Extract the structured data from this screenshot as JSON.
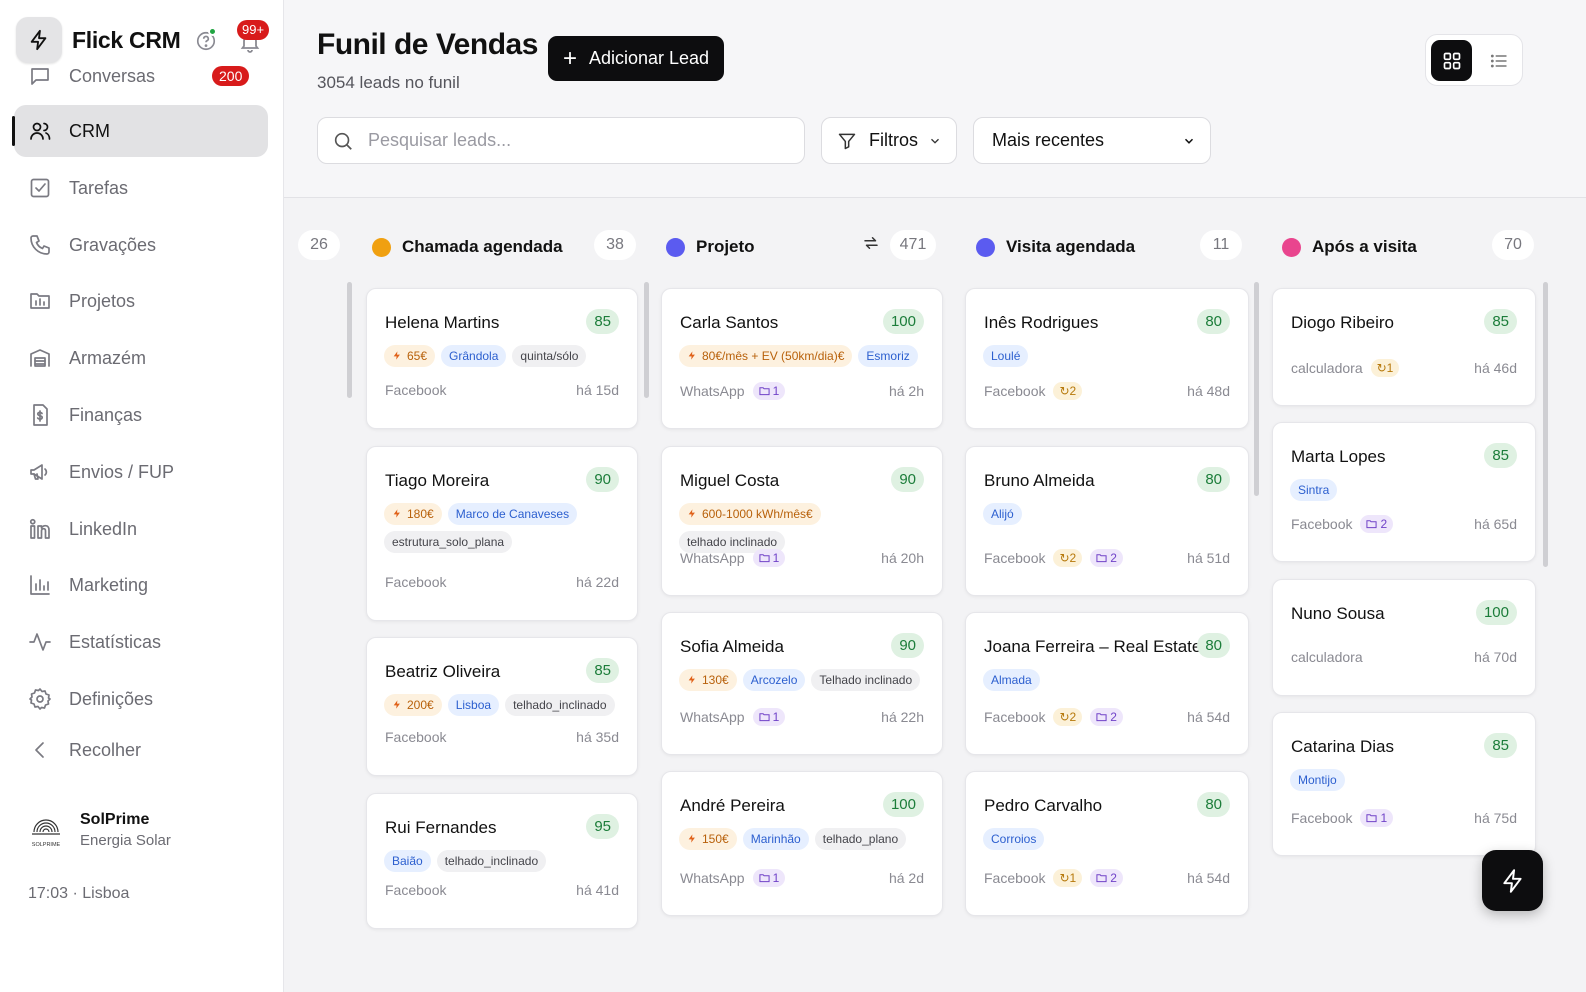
{
  "app": {
    "name": "Flick CRM",
    "notifications_badge": "99+"
  },
  "sidebar": {
    "items": [
      {
        "label": "Conversas",
        "icon": "chat-icon",
        "badge": "200"
      },
      {
        "label": "CRM",
        "icon": "users-icon",
        "active": true
      },
      {
        "label": "Tarefas",
        "icon": "checkbox-icon"
      },
      {
        "label": "Gravações",
        "icon": "phone-icon"
      },
      {
        "label": "Projetos",
        "icon": "chart-folder-icon"
      },
      {
        "label": "Armazém",
        "icon": "warehouse-icon"
      },
      {
        "label": "Finanças",
        "icon": "dollar-file-icon"
      },
      {
        "label": "Envios / FUP",
        "icon": "megaphone-icon"
      },
      {
        "label": "LinkedIn",
        "icon": "linkedin-icon"
      },
      {
        "label": "Marketing",
        "icon": "bar-chart-icon"
      },
      {
        "label": "Estatísticas",
        "icon": "activity-icon"
      },
      {
        "label": "Definições",
        "icon": "settings-icon"
      },
      {
        "label": "Recolher",
        "icon": "chevron-left-icon"
      }
    ],
    "org": {
      "name": "SolPrime",
      "subtitle": "Energia Solar",
      "logo_text": "SOLPRIME"
    },
    "clock": "17:03 · Lisboa"
  },
  "header": {
    "title": "Funil de Vendas",
    "subtitle": "3054 leads no funil",
    "add_button": "Adicionar Lead",
    "search_placeholder": "Pesquisar leads...",
    "filters_label": "Filtros",
    "sort_selected": "Mais recentes"
  },
  "board": {
    "hidden_count": "26",
    "columns": [
      {
        "title": "Chamada agendada",
        "count": "38",
        "color": "#f0a010",
        "cards": [
          {
            "name": "Helena Martins",
            "score": "85",
            "tags": [
              {
                "t": "value",
                "v": "65€"
              },
              {
                "t": "loc",
                "v": "Grândola"
              },
              {
                "t": "plain",
                "v": "quinta/sólo"
              }
            ],
            "source": "Facebook",
            "time": "há 15d"
          },
          {
            "name": "Tiago Moreira",
            "score": "90",
            "tags": [
              {
                "t": "value",
                "v": "180€"
              },
              {
                "t": "loc",
                "v": "Marco de Canaveses"
              },
              {
                "t": "plain",
                "v": "estrutura_solo_plana"
              }
            ],
            "source": "Facebook",
            "time": "há 22d"
          },
          {
            "name": "Beatriz Oliveira",
            "score": "85",
            "tags": [
              {
                "t": "value",
                "v": "200€"
              },
              {
                "t": "loc",
                "v": "Lisboa"
              },
              {
                "t": "plain",
                "v": "telhado_inclinado"
              }
            ],
            "source": "Facebook",
            "time": "há 35d"
          },
          {
            "name": "Rui Fernandes",
            "score": "95",
            "tags": [
              {
                "t": "loc",
                "v": "Baião"
              },
              {
                "t": "plain",
                "v": "telhado_inclinado"
              }
            ],
            "source": "Facebook",
            "time": "há 41d"
          }
        ]
      },
      {
        "title": "Projeto",
        "count": "471",
        "color": "#5b5bf0",
        "cards": [
          {
            "name": "Carla Santos",
            "score": "100",
            "tags": [
              {
                "t": "value",
                "v": "80€/mês + EV (50km/dia)€"
              },
              {
                "t": "loc",
                "v": "Esmoriz"
              }
            ],
            "source": "WhatsApp",
            "proj": "1",
            "time": "há 2h"
          },
          {
            "name": "Miguel Costa",
            "score": "90",
            "tags": [
              {
                "t": "value",
                "v": "600-1000 kWh/mês€"
              },
              {
                "t": "plain",
                "v": "telhado inclinado"
              }
            ],
            "source": "WhatsApp",
            "proj": "1",
            "time": "há 20h"
          },
          {
            "name": "Sofia Almeida",
            "score": "90",
            "tags": [
              {
                "t": "value",
                "v": "130€"
              },
              {
                "t": "loc",
                "v": "Arcozelo"
              },
              {
                "t": "plain",
                "v": "Telhado inclinado"
              }
            ],
            "source": "WhatsApp",
            "proj": "1",
            "time": "há 22h"
          },
          {
            "name": "André Pereira",
            "score": "100",
            "tags": [
              {
                "t": "value",
                "v": "150€"
              },
              {
                "t": "loc",
                "v": "Marinhão"
              },
              {
                "t": "plain",
                "v": "telhado_plano"
              }
            ],
            "source": "WhatsApp",
            "proj": "1",
            "time": "há 2d"
          }
        ]
      },
      {
        "title": "Visita agendada",
        "count": "11",
        "color": "#5b5bf0",
        "cards": [
          {
            "name": "Inês Rodrigues",
            "score": "80",
            "tags": [
              {
                "t": "loc",
                "v": "Loulé"
              }
            ],
            "source": "Facebook",
            "rep": "2",
            "time": "há 48d"
          },
          {
            "name": "Bruno Almeida",
            "score": "80",
            "tags": [
              {
                "t": "loc",
                "v": "Alijó"
              }
            ],
            "source": "Facebook",
            "rep": "2",
            "proj": "2",
            "time": "há 51d"
          },
          {
            "name": "Joana Ferreira – Real Estate",
            "score": "80",
            "tags": [
              {
                "t": "loc",
                "v": "Almada"
              }
            ],
            "source": "Facebook",
            "rep": "2",
            "proj": "2",
            "time": "há 54d"
          },
          {
            "name": "Pedro Carvalho",
            "score": "80",
            "tags": [
              {
                "t": "loc",
                "v": "Corroios"
              }
            ],
            "source": "Facebook",
            "rep": "1",
            "proj": "2",
            "time": "há 54d"
          }
        ]
      },
      {
        "title": "Após a visita",
        "count": "70",
        "color": "#e9458e",
        "cards": [
          {
            "name": "Diogo Ribeiro",
            "score": "85",
            "tags": [],
            "source": "calculadora",
            "rep": "1",
            "time": "há 46d"
          },
          {
            "name": "Marta Lopes",
            "score": "85",
            "tags": [
              {
                "t": "loc",
                "v": "Sintra"
              }
            ],
            "source": "Facebook",
            "proj": "2",
            "time": "há 65d"
          },
          {
            "name": "Nuno Sousa",
            "score": "100",
            "tags": [],
            "source": "calculadora",
            "time": "há 70d"
          },
          {
            "name": "Catarina Dias",
            "score": "85",
            "tags": [
              {
                "t": "loc",
                "v": "Montijo"
              }
            ],
            "source": "Facebook",
            "proj": "1",
            "time": "há 75d"
          }
        ]
      }
    ]
  }
}
